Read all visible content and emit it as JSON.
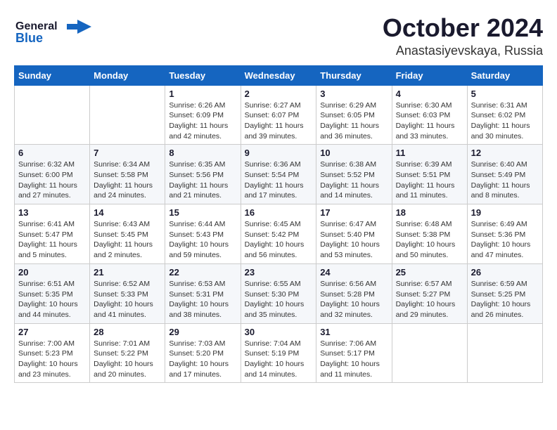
{
  "header": {
    "logo_general": "General",
    "logo_blue": "Blue",
    "month": "October 2024",
    "location": "Anastasiyevskaya, Russia"
  },
  "weekdays": [
    "Sunday",
    "Monday",
    "Tuesday",
    "Wednesday",
    "Thursday",
    "Friday",
    "Saturday"
  ],
  "weeks": [
    [
      {
        "day": "",
        "info": ""
      },
      {
        "day": "",
        "info": ""
      },
      {
        "day": "1",
        "info": "Sunrise: 6:26 AM\nSunset: 6:09 PM\nDaylight: 11 hours and 42 minutes."
      },
      {
        "day": "2",
        "info": "Sunrise: 6:27 AM\nSunset: 6:07 PM\nDaylight: 11 hours and 39 minutes."
      },
      {
        "day": "3",
        "info": "Sunrise: 6:29 AM\nSunset: 6:05 PM\nDaylight: 11 hours and 36 minutes."
      },
      {
        "day": "4",
        "info": "Sunrise: 6:30 AM\nSunset: 6:03 PM\nDaylight: 11 hours and 33 minutes."
      },
      {
        "day": "5",
        "info": "Sunrise: 6:31 AM\nSunset: 6:02 PM\nDaylight: 11 hours and 30 minutes."
      }
    ],
    [
      {
        "day": "6",
        "info": "Sunrise: 6:32 AM\nSunset: 6:00 PM\nDaylight: 11 hours and 27 minutes."
      },
      {
        "day": "7",
        "info": "Sunrise: 6:34 AM\nSunset: 5:58 PM\nDaylight: 11 hours and 24 minutes."
      },
      {
        "day": "8",
        "info": "Sunrise: 6:35 AM\nSunset: 5:56 PM\nDaylight: 11 hours and 21 minutes."
      },
      {
        "day": "9",
        "info": "Sunrise: 6:36 AM\nSunset: 5:54 PM\nDaylight: 11 hours and 17 minutes."
      },
      {
        "day": "10",
        "info": "Sunrise: 6:38 AM\nSunset: 5:52 PM\nDaylight: 11 hours and 14 minutes."
      },
      {
        "day": "11",
        "info": "Sunrise: 6:39 AM\nSunset: 5:51 PM\nDaylight: 11 hours and 11 minutes."
      },
      {
        "day": "12",
        "info": "Sunrise: 6:40 AM\nSunset: 5:49 PM\nDaylight: 11 hours and 8 minutes."
      }
    ],
    [
      {
        "day": "13",
        "info": "Sunrise: 6:41 AM\nSunset: 5:47 PM\nDaylight: 11 hours and 5 minutes."
      },
      {
        "day": "14",
        "info": "Sunrise: 6:43 AM\nSunset: 5:45 PM\nDaylight: 11 hours and 2 minutes."
      },
      {
        "day": "15",
        "info": "Sunrise: 6:44 AM\nSunset: 5:43 PM\nDaylight: 10 hours and 59 minutes."
      },
      {
        "day": "16",
        "info": "Sunrise: 6:45 AM\nSunset: 5:42 PM\nDaylight: 10 hours and 56 minutes."
      },
      {
        "day": "17",
        "info": "Sunrise: 6:47 AM\nSunset: 5:40 PM\nDaylight: 10 hours and 53 minutes."
      },
      {
        "day": "18",
        "info": "Sunrise: 6:48 AM\nSunset: 5:38 PM\nDaylight: 10 hours and 50 minutes."
      },
      {
        "day": "19",
        "info": "Sunrise: 6:49 AM\nSunset: 5:36 PM\nDaylight: 10 hours and 47 minutes."
      }
    ],
    [
      {
        "day": "20",
        "info": "Sunrise: 6:51 AM\nSunset: 5:35 PM\nDaylight: 10 hours and 44 minutes."
      },
      {
        "day": "21",
        "info": "Sunrise: 6:52 AM\nSunset: 5:33 PM\nDaylight: 10 hours and 41 minutes."
      },
      {
        "day": "22",
        "info": "Sunrise: 6:53 AM\nSunset: 5:31 PM\nDaylight: 10 hours and 38 minutes."
      },
      {
        "day": "23",
        "info": "Sunrise: 6:55 AM\nSunset: 5:30 PM\nDaylight: 10 hours and 35 minutes."
      },
      {
        "day": "24",
        "info": "Sunrise: 6:56 AM\nSunset: 5:28 PM\nDaylight: 10 hours and 32 minutes."
      },
      {
        "day": "25",
        "info": "Sunrise: 6:57 AM\nSunset: 5:27 PM\nDaylight: 10 hours and 29 minutes."
      },
      {
        "day": "26",
        "info": "Sunrise: 6:59 AM\nSunset: 5:25 PM\nDaylight: 10 hours and 26 minutes."
      }
    ],
    [
      {
        "day": "27",
        "info": "Sunrise: 7:00 AM\nSunset: 5:23 PM\nDaylight: 10 hours and 23 minutes."
      },
      {
        "day": "28",
        "info": "Sunrise: 7:01 AM\nSunset: 5:22 PM\nDaylight: 10 hours and 20 minutes."
      },
      {
        "day": "29",
        "info": "Sunrise: 7:03 AM\nSunset: 5:20 PM\nDaylight: 10 hours and 17 minutes."
      },
      {
        "day": "30",
        "info": "Sunrise: 7:04 AM\nSunset: 5:19 PM\nDaylight: 10 hours and 14 minutes."
      },
      {
        "day": "31",
        "info": "Sunrise: 7:06 AM\nSunset: 5:17 PM\nDaylight: 10 hours and 11 minutes."
      },
      {
        "day": "",
        "info": ""
      },
      {
        "day": "",
        "info": ""
      }
    ]
  ]
}
